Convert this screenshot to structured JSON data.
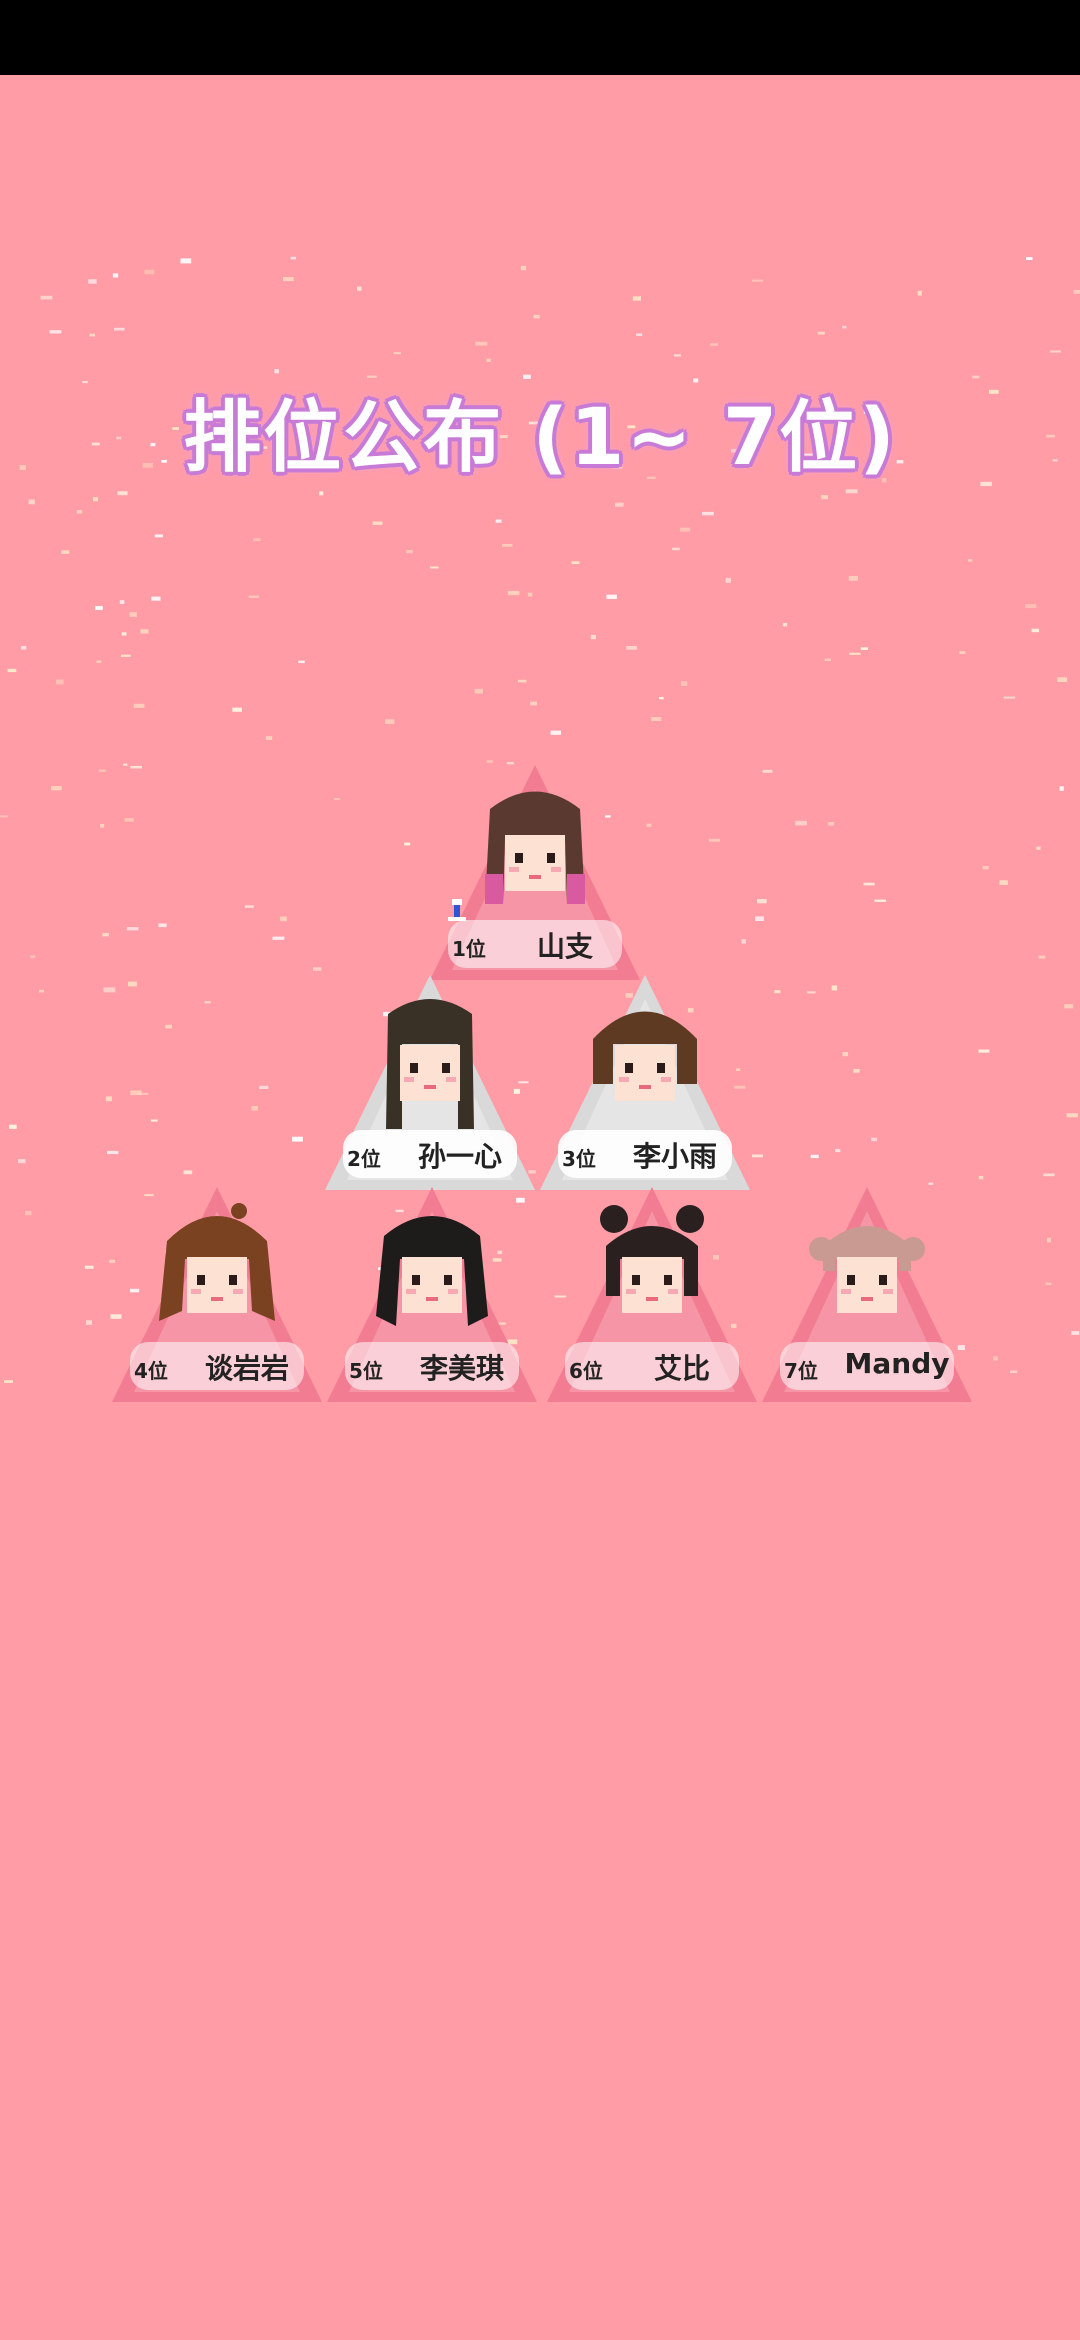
{
  "title": "排位公布 (1~ 7位)",
  "colors": {
    "background": "#ff9ca6",
    "title_outline": "#c77bd6",
    "card_pink": "#f27c92",
    "card_grey": "#d9d9d9"
  },
  "ranking": [
    {
      "rank": "1位",
      "name": "山支",
      "card": "pink",
      "hair": "#5a3a30",
      "hair_tip": "#d95aa0",
      "style": "long-ombre",
      "badge_icon": "crown-icon"
    },
    {
      "rank": "2位",
      "name": "孙一心",
      "card": "grey",
      "hair": "#3a3126",
      "style": "long-bangs"
    },
    {
      "rank": "3位",
      "name": "李小雨",
      "card": "grey",
      "hair": "#5e3a22",
      "style": "bob"
    },
    {
      "rank": "4位",
      "name": "谈岩岩",
      "card": "pink",
      "hair": "#7a4220",
      "style": "wavy"
    },
    {
      "rank": "5位",
      "name": "李美琪",
      "card": "pink",
      "hair": "#1e1b1b",
      "style": "curly"
    },
    {
      "rank": "6位",
      "name": "艾比",
      "card": "pink",
      "hair": "#2a2020",
      "style": "buns"
    },
    {
      "rank": "7位",
      "name": "Mandy",
      "card": "pink",
      "hair": "#c99a92",
      "style": "short-pink"
    }
  ]
}
